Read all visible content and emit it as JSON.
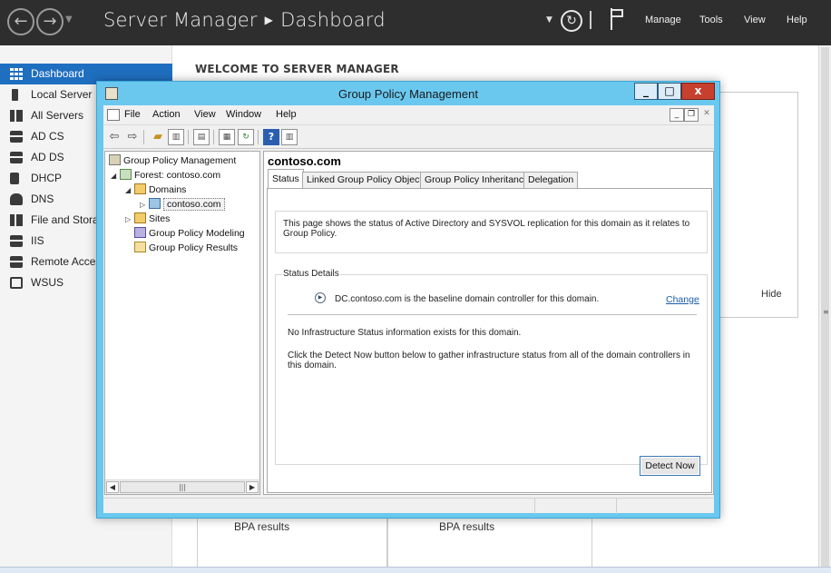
{
  "server_manager": {
    "title": "Server Manager",
    "breadcrumb_current": "Dashboard",
    "menus": [
      "Manage",
      "Tools",
      "View",
      "Help"
    ],
    "sidebar": [
      {
        "label": "Dashboard",
        "icon": "dashboard-icon",
        "active": true
      },
      {
        "label": "Local Server",
        "icon": "server-icon"
      },
      {
        "label": "All Servers",
        "icon": "servers-icon"
      },
      {
        "label": "AD CS",
        "icon": "ad-cs-icon"
      },
      {
        "label": "AD DS",
        "icon": "ad-ds-icon"
      },
      {
        "label": "DHCP",
        "icon": "dhcp-icon"
      },
      {
        "label": "DNS",
        "icon": "dns-icon"
      },
      {
        "label": "File and Storage Services",
        "icon": "file-storage-icon"
      },
      {
        "label": "IIS",
        "icon": "iis-icon"
      },
      {
        "label": "Remote Access",
        "icon": "remote-access-icon"
      },
      {
        "label": "WSUS",
        "icon": "wsus-icon"
      }
    ],
    "welcome_title": "WELCOME TO SERVER MANAGER",
    "hide_label": "Hide",
    "bpa_labels": [
      "BPA results",
      "BPA results"
    ]
  },
  "gpm": {
    "window_title": "Group Policy Management",
    "menu": [
      "File",
      "Action",
      "View",
      "Window",
      "Help"
    ],
    "tree": [
      {
        "label": "Group Policy Management",
        "level": 0,
        "expander": "",
        "icon": "gpm-icon"
      },
      {
        "label": "Forest: contoso.com",
        "level": 1,
        "expander": "◢",
        "icon": "forest-icon"
      },
      {
        "label": "Domains",
        "level": 2,
        "expander": "◢",
        "icon": "domains-icon"
      },
      {
        "label": "contoso.com",
        "level": 3,
        "expander": "▷",
        "icon": "domain-icon",
        "selected": true
      },
      {
        "label": "Sites",
        "level": 2,
        "expander": "▷",
        "icon": "sites-icon"
      },
      {
        "label": "Group Policy Modeling",
        "level": 2,
        "expander": "",
        "icon": "modeling-icon"
      },
      {
        "label": "Group Policy Results",
        "level": 2,
        "expander": "",
        "icon": "results-icon"
      }
    ],
    "content": {
      "domain": "contoso.com",
      "tabs": [
        {
          "label": "Status",
          "active": true
        },
        {
          "label": "Linked Group Policy Objects"
        },
        {
          "label": "Group Policy Inheritance"
        },
        {
          "label": "Delegation"
        }
      ],
      "status_intro": "This page shows the status of Active Directory and SYSVOL replication for this domain as it relates to Group Policy.",
      "status_details_label": "Status Details",
      "baseline_text": "DC.contoso.com is the baseline domain controller for this domain.",
      "change_link": "Change",
      "no_info_text": "No Infrastructure Status information exists for this domain.",
      "detect_instructions": "Click the Detect Now button below to gather infrastructure status from all of the domain controllers in this domain.",
      "detect_button": "Detect Now"
    }
  }
}
